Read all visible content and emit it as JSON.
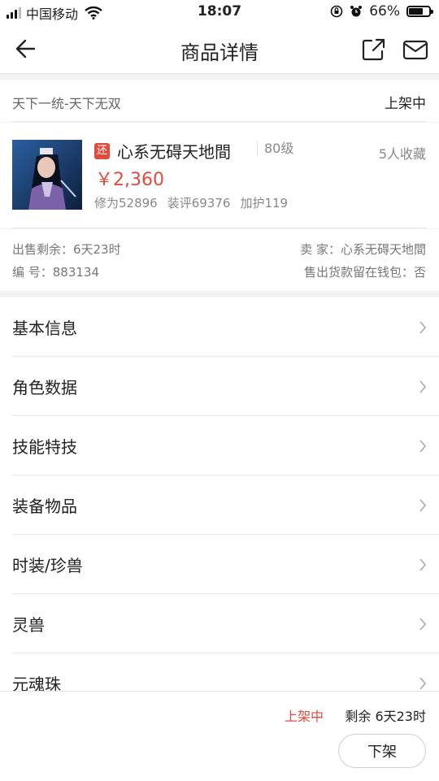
{
  "status_bar": {
    "carrier": "中国移动",
    "time": "18:07",
    "battery": "66%",
    "battery_level": 0.66,
    "icons": [
      "signal-icon",
      "wifi-icon",
      "rotation-lock-icon",
      "alarm-icon",
      "battery-icon"
    ]
  },
  "header": {
    "title": "商品详情",
    "icons": [
      "back-arrow-icon",
      "share-icon",
      "mail-icon"
    ]
  },
  "listing": {
    "server": "天下一统-天下无双",
    "status": "上架中"
  },
  "product": {
    "badge": "还",
    "name": "心系无碍天地間",
    "level": "80级",
    "favorites": "5人收藏",
    "price": "￥2,360",
    "stats": [
      "修为52896",
      "装评69376",
      "加护119"
    ]
  },
  "meta": {
    "remaining": "出售剩余：6天23时",
    "seller": "卖 家：心系无碍天地間",
    "id": "编 号：883134",
    "wallet": "售出货款留在钱包：否"
  },
  "menu": {
    "items": [
      {
        "label": "基本信息"
      },
      {
        "label": "角色数据"
      },
      {
        "label": "技能特技"
      },
      {
        "label": "装备物品"
      },
      {
        "label": "时装/珍兽"
      },
      {
        "label": "灵兽"
      },
      {
        "label": "元魂珠"
      }
    ]
  },
  "footer": {
    "status": "上架中",
    "remaining": "剩余 6天23时",
    "button": "下架"
  },
  "colors": {
    "accent_red": "#e04b3d",
    "text_primary": "#222222",
    "text_secondary": "#888888",
    "background": "#f2f2f2"
  }
}
